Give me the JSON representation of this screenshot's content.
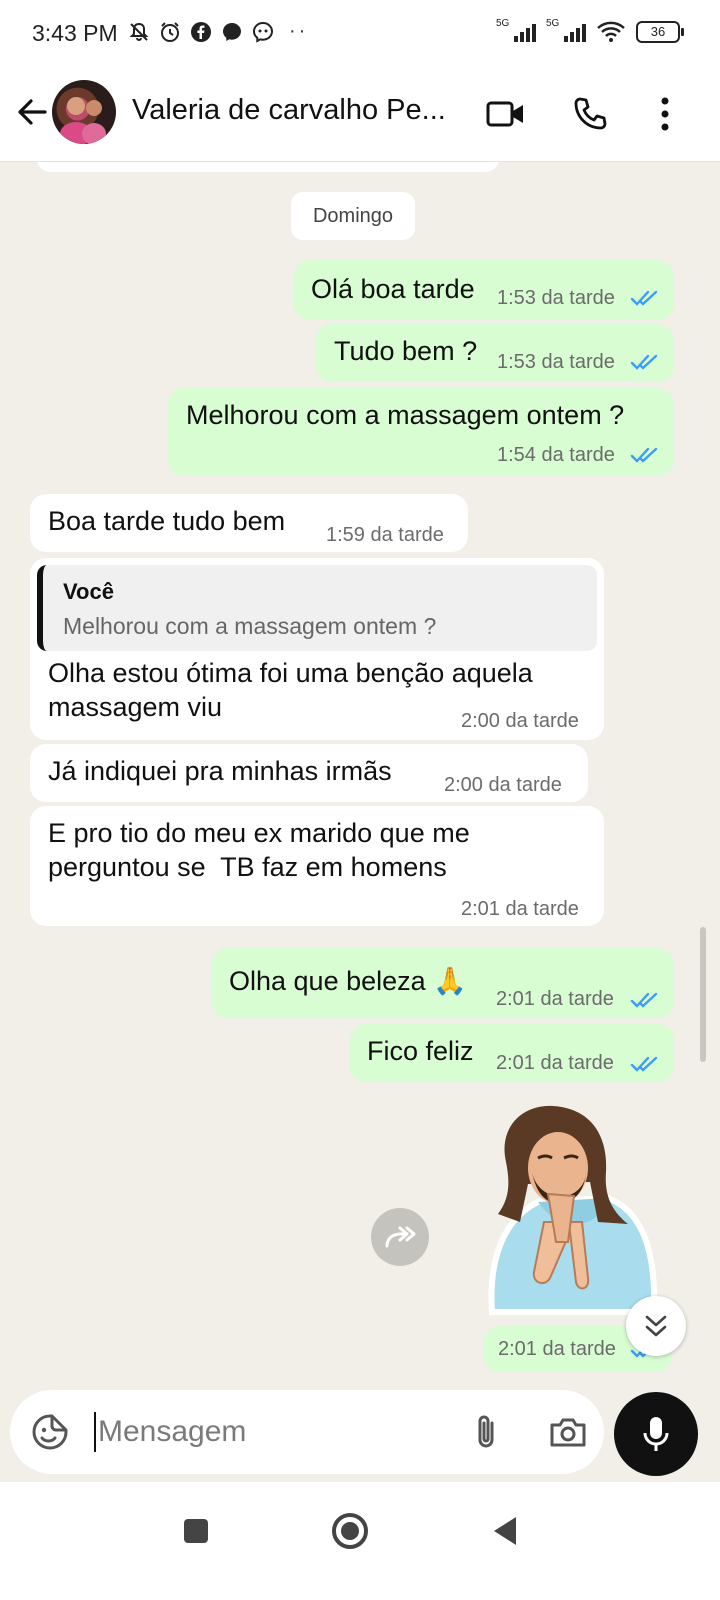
{
  "status_bar": {
    "time": "3:43 PM",
    "signal_1_label": "5G",
    "signal_2_label": "5G",
    "battery": "36",
    "icons": [
      "mute-bell-icon",
      "alarm-icon",
      "facebook-icon",
      "messenger-icon",
      "messenger-game-icon",
      "more-dots-icon",
      "wifi-icon"
    ]
  },
  "header": {
    "contact_name": "Valeria de carvalho Pe...",
    "icons": [
      "back-arrow-icon",
      "video-call-icon",
      "phone-icon",
      "more-vert-icon"
    ]
  },
  "chat": {
    "date_chip": "Domingo",
    "messages": [
      {
        "direction": "out",
        "text": "Olá boa tarde",
        "time": "1:53 da tarde",
        "read": true
      },
      {
        "direction": "out",
        "text": "Tudo bem ?",
        "time": "1:53 da tarde",
        "read": true
      },
      {
        "direction": "out",
        "text": "Melhorou com a massagem ontem ?",
        "time": "1:54 da tarde",
        "read": true
      },
      {
        "direction": "in",
        "text": "Boa tarde tudo bem",
        "time": "1:59 da tarde"
      },
      {
        "direction": "in",
        "quote_author": "Você",
        "quote_text": "Melhorou com a massagem ontem ?",
        "text_line1": "Olha estou ótima foi uma benção aquela",
        "text_line2": "massagem viu",
        "time": "2:00 da tarde"
      },
      {
        "direction": "in",
        "text": "Já indiquei pra minhas irmãs",
        "time": "2:00 da tarde"
      },
      {
        "direction": "in",
        "text_line1": "E pro tio do meu ex marido que me",
        "text_line2": "perguntou se  TB faz em homens",
        "time": "2:01 da tarde"
      },
      {
        "direction": "out",
        "text": "Olha que beleza 🙏",
        "time": "2:01 da tarde",
        "read": true
      },
      {
        "direction": "out",
        "text": "Fico feliz",
        "time": "2:01 da tarde",
        "read": true
      },
      {
        "direction": "out",
        "type": "sticker",
        "sticker": "praying-jesus-sticker",
        "time": "2:01 da tarde",
        "read": true
      }
    ]
  },
  "input": {
    "placeholder": "Mensagem",
    "value": ""
  },
  "colors": {
    "outgoing_bubble": "#d9fdd3",
    "incoming_bubble": "#ffffff",
    "chat_background": "#f2efe8",
    "read_ticks": "#3b9df3"
  }
}
